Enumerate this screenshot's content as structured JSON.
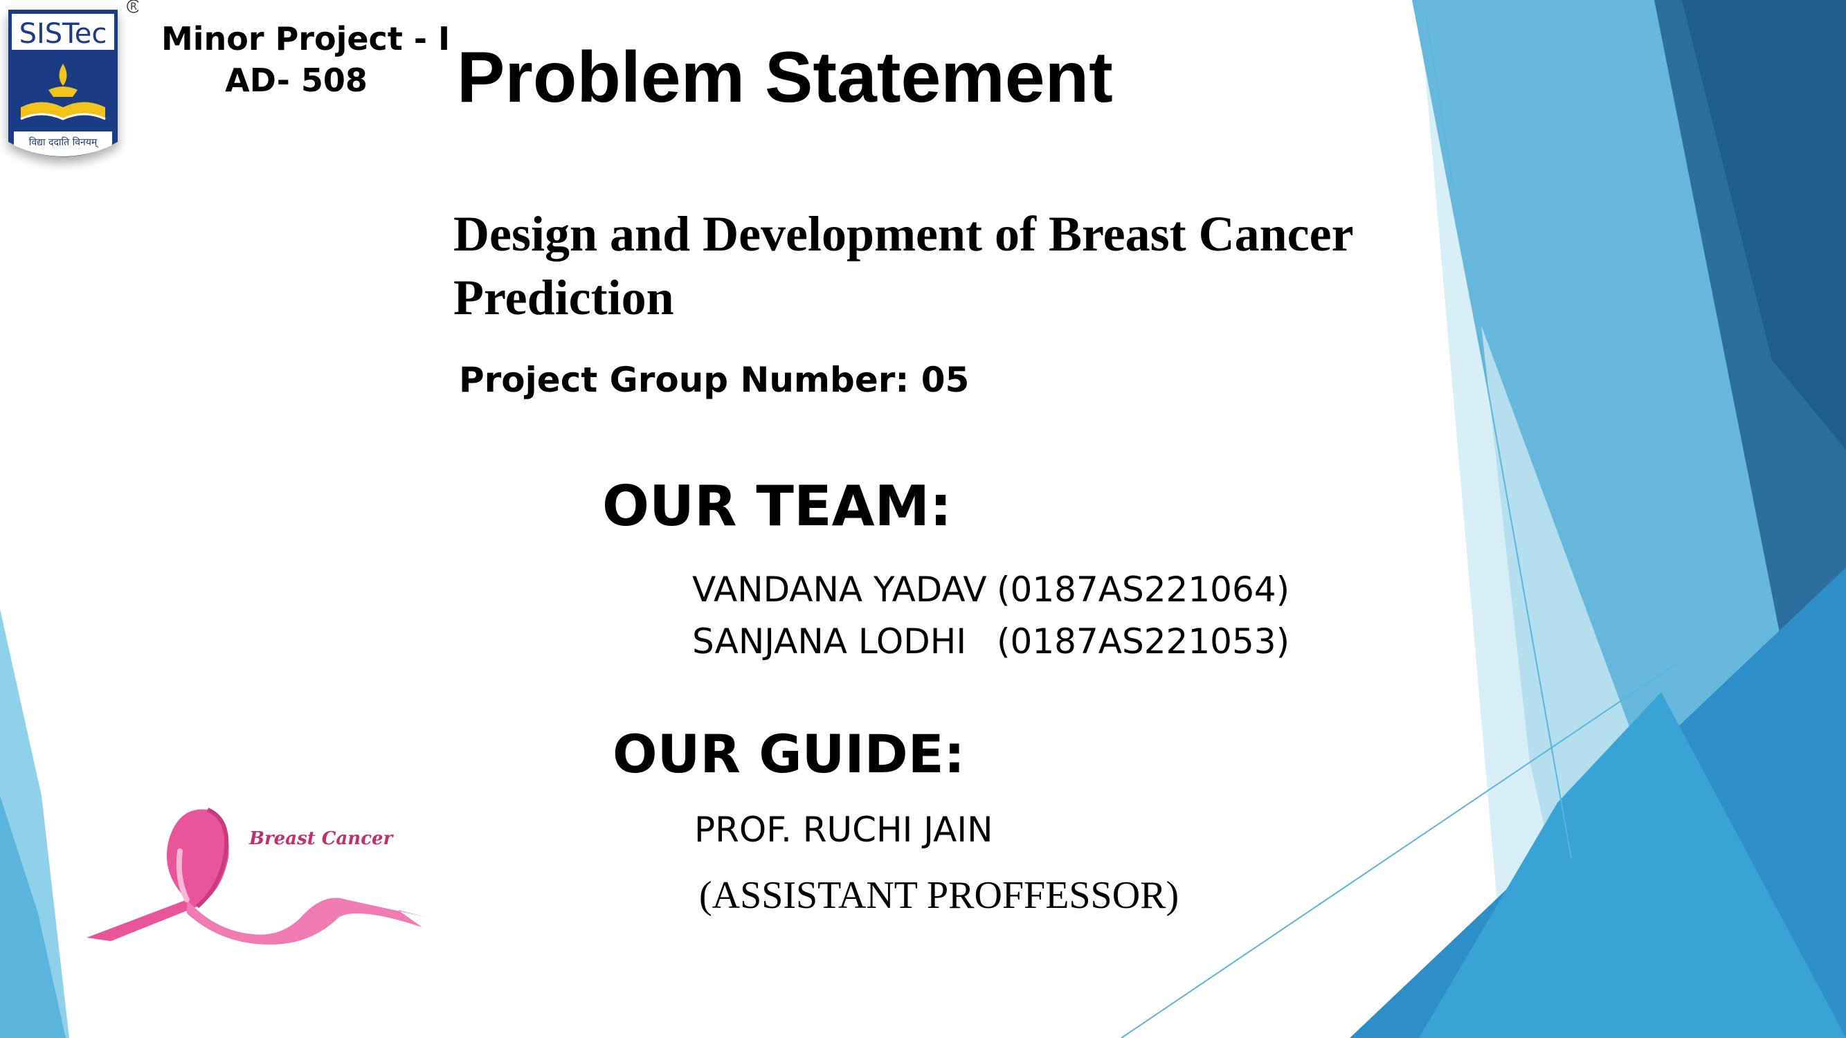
{
  "colors": {
    "accent_dark": "#1f5d8c",
    "accent": "#2e8fc8",
    "accent_light": "#8fd0ea",
    "ribbon": "#e8559a"
  },
  "header": {
    "course_line1": "Minor Project - I",
    "course_line2": "AD- 508"
  },
  "logo": {
    "name": "SISTec",
    "registered": "R",
    "motto": "विद्या ददाति विनयम्"
  },
  "title": "Problem Statement",
  "subtitle": {
    "line1": "Design and Development of Breast Cancer",
    "line2": "Prediction"
  },
  "group": "Project Group Number: 05",
  "team": {
    "heading": "OUR TEAM:",
    "members": [
      {
        "name": "VANDANA YADAV",
        "id": "(0187AS221064)"
      },
      {
        "name": "SANJANA LODHI",
        "id": "(0187AS221053)"
      }
    ]
  },
  "guide": {
    "heading": "OUR GUIDE:",
    "name": "PROF. RUCHI JAIN",
    "role": "(ASSISTANT PROFFESSOR)"
  },
  "ribbon": {
    "label": "Breast Cancer",
    "icon": "pink-ribbon-icon"
  }
}
